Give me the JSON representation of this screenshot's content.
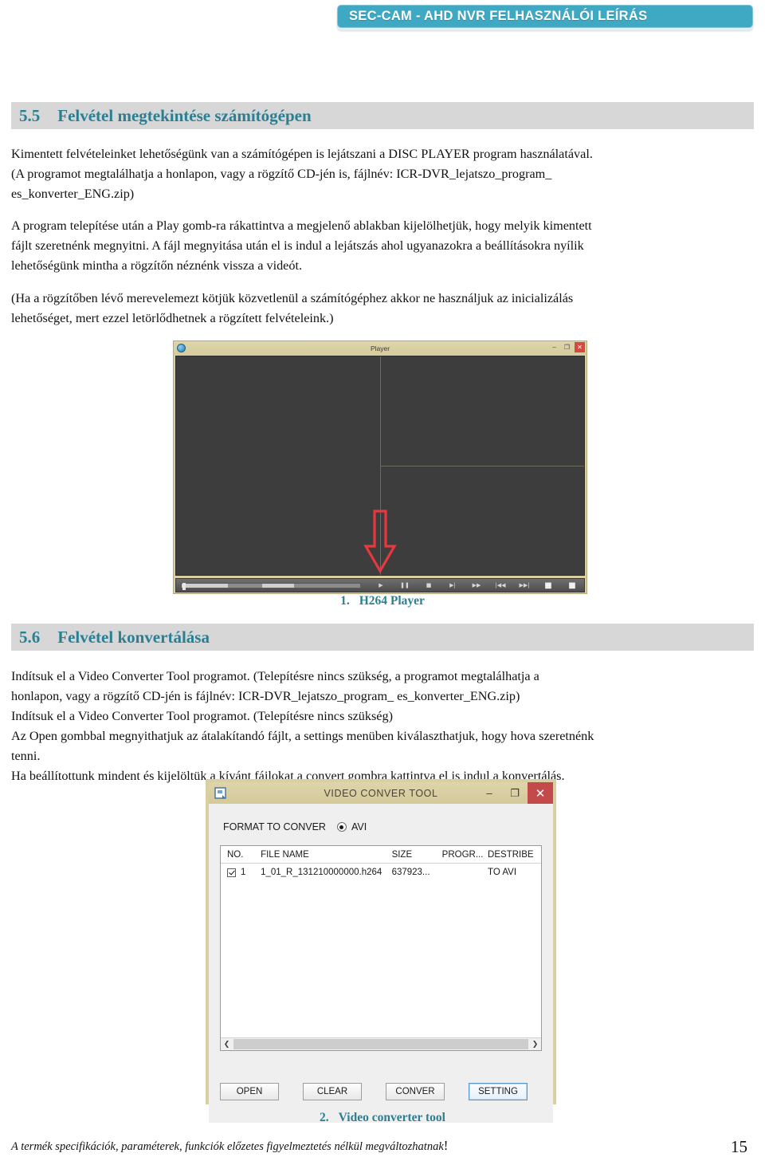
{
  "header": {
    "banner_title": "SEC-CAM - AHD NVR FELHASZNÁLÓI LEÍRÁS",
    "banner_color": "#3fa9c4"
  },
  "sections": {
    "s55": {
      "number": "5.5",
      "title": "Felvétel megtekintése számítógépen",
      "paragraph1_line1": "Kimentett felvételeinket lehetőségünk van a számítógépen is lejátszani a DISC PLAYER program használatával.",
      "paragraph1_line2": "(A programot megtalálhatja a honlapon, vagy a rögzítő CD-jén is, fájlnév: ICR-DVR_lejatszo_program_",
      "paragraph1_line3": "es_konverter_ENG.zip)",
      "paragraph2_line1": "A program telepítése után a Play gomb-ra rákattintva a megjelenő ablakban kijelölhetjük, hogy melyik kimentett",
      "paragraph2_line2": "fájlt szeretnénk megnyitni. A fájl megnyitása után el is indul a lejátszás ahol ugyanazokra a beállításokra nyílik",
      "paragraph2_line3": "lehetőségünk mintha a rögzítőn néznénk vissza a videót.",
      "paragraph3_line1": "(Ha a rögzítőben lévő merevelemezt kötjük közvetlenül a számítógéphez akkor ne használjuk az inicializálás",
      "paragraph3_line2": "lehetőséget, mert ezzel letörlődhetnek a rögzített felvételeink.)"
    },
    "s56": {
      "number": "5.6",
      "title": "Felvétel konvertálása",
      "paragraph1_line1": "Indítsuk el a Video Converter Tool programot. (Telepítésre nincs szükség, a programot megtalálhatja a",
      "paragraph1_line2": "honlapon, vagy a rögzítő CD-jén is fájlnév: ICR-DVR_lejatszo_program_ es_konverter_ENG.zip)",
      "paragraph2": "Indítsuk el a Video Converter Tool programot. (Telepítésre nincs szükség)",
      "paragraph3_line1": "Az Open gombbal megnyithatjuk az átalakítandó fájlt, a settings menüben kiválaszthatjuk, hogy hova szeretnénk",
      "paragraph3_line2": "tenni.",
      "paragraph4": "Ha beállítottunk mindent és kijelöltük a kívánt fájlokat a convert gombra kattintva el is indul a konvertálás."
    }
  },
  "player_window": {
    "title": "Player",
    "app_icon": "globe-icon",
    "minimize_label": "–",
    "maximize_label": "❐",
    "close_label": "✕",
    "controls": [
      {
        "name": "play-button",
        "glyph": "▶"
      },
      {
        "name": "pause-button",
        "glyph": "❚❚"
      },
      {
        "name": "stop-button",
        "glyph": "■"
      },
      {
        "name": "slow-forward-button",
        "glyph": "▶|"
      },
      {
        "name": "fast-forward-button",
        "glyph": "▶▶"
      },
      {
        "name": "previous-button",
        "glyph": "|◀◀"
      },
      {
        "name": "next-button",
        "glyph": "▶▶|"
      },
      {
        "name": "capture-button",
        "glyph": "■"
      },
      {
        "name": "record-button",
        "glyph": "■"
      }
    ],
    "annotation": "red-down-arrow-pointing-to-play"
  },
  "figure1": {
    "number": "1.",
    "caption": "H264 Player",
    "caption_color": "#2b7f93"
  },
  "converter_window": {
    "title": "VIDEO CONVER TOOL",
    "app_icon": "converter-app-icon",
    "minimize_label": "–",
    "maximize_label": "❐",
    "close_label": "✕",
    "format_label": "FORMAT TO CONVER",
    "format_option": "AVI",
    "table": {
      "columns": [
        "NO.",
        "FILE NAME",
        "SIZE",
        "PROGR...",
        "DESTRIBE"
      ],
      "rows": [
        {
          "checked": true,
          "no": "1",
          "file_name": "1_01_R_131210000000.h264",
          "size": "637923...",
          "progress": "",
          "describe": "TO AVI"
        }
      ]
    },
    "scroll_left": "❮",
    "scroll_right": "❯",
    "buttons": [
      {
        "name": "open-button",
        "label": "OPEN",
        "focused": false
      },
      {
        "name": "clear-button",
        "label": "CLEAR",
        "focused": false
      },
      {
        "name": "conver-button",
        "label": "CONVER",
        "focused": false
      },
      {
        "name": "setting-button",
        "label": "SETTING",
        "focused": true
      }
    ]
  },
  "figure2": {
    "number": "2.",
    "caption": "Video converter tool",
    "caption_color": "#2b7f93"
  },
  "footer": {
    "disclaimer": "A termék specifikációk, paraméterek, funkciók előzetes figyelmeztetés nélkül megváltozhatnak",
    "exclamation": "!",
    "page_number": "15"
  }
}
